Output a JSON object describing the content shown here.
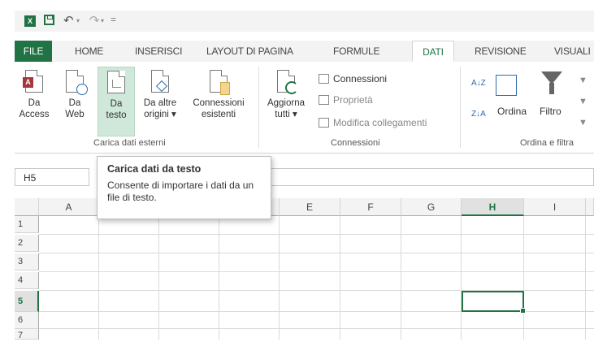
{
  "qat": {
    "app_icon": "excel-icon",
    "save_icon": "save-icon",
    "undo_icon": "undo-icon",
    "redo_icon": "redo-icon",
    "dd1": "▾",
    "dd2": "▾",
    "customize": "="
  },
  "tabs": [
    {
      "label": "FILE"
    },
    {
      "label": "HOME"
    },
    {
      "label": "INSERISCI"
    },
    {
      "label": "LAYOUT DI PAGINA"
    },
    {
      "label": "FORMULE"
    },
    {
      "label": "DATI"
    },
    {
      "label": "REVISIONE"
    },
    {
      "label": "VISUALI"
    }
  ],
  "ribbon": {
    "buttons": {
      "da_access": "Da\nAccess",
      "da_web": "Da\nWeb",
      "da_testo": "Da\ntesto",
      "da_altre": "Da altre\norigini ▾",
      "connessioni_esistenti": "Connessioni\nesistenti",
      "aggiorna": "Aggiorna\ntutti ▾",
      "ordina": "Ordina",
      "filtro": "Filtro"
    },
    "small": {
      "connessioni": "Connessioni",
      "proprieta": "Proprietà",
      "modifica": "Modifica collegamenti"
    },
    "groups": {
      "carica": "Carica dati esterni",
      "connessioni": "Connessioni",
      "ordina": "Ordina e filtra"
    },
    "sort_az": "A↓Z",
    "sort_za": "Z↓A"
  },
  "namebox": {
    "value": "H5"
  },
  "columns": [
    "A",
    "B",
    "C",
    "D",
    "E",
    "F",
    "G",
    "H",
    "I"
  ],
  "rows": [
    "1",
    "2",
    "3",
    "4",
    "5",
    "6",
    "7"
  ],
  "selected": {
    "col": "H",
    "row": "5"
  },
  "tooltip": {
    "title": "Carica dati da testo",
    "body": "Consente di importare i dati da un file di testo."
  },
  "colors": {
    "accent": "#217346",
    "highlight": "#cfe8da"
  }
}
